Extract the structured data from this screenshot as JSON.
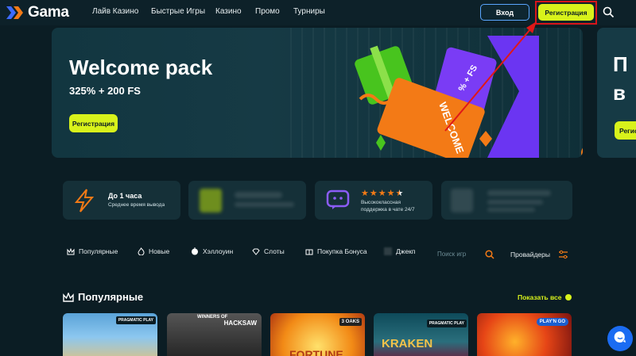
{
  "header": {
    "logo_text": "Gama",
    "nav": [
      "Лайв Казино",
      "Быстрые Игры",
      "Казино",
      "Промо",
      "Турниры"
    ],
    "login_label": "Вход",
    "register_label": "Регистрация"
  },
  "hero": {
    "title": "Welcome pack",
    "subtitle": "325% + 200 FS",
    "button_label": "Регистрация",
    "art_text": "WELCOME",
    "art_text2": "% + FS",
    "next_title": "П\nв",
    "next_button": "Регис"
  },
  "features": [
    {
      "title": "До 1 часа",
      "subtitle": "Среднее время вывода"
    },
    {
      "title": "",
      "subtitle": ""
    },
    {
      "title": "",
      "subtitle": "Высококлассная поддержка в чате 24/7",
      "rating": 4.5
    },
    {
      "title": "",
      "subtitle": ""
    }
  ],
  "categories": [
    "Популярные",
    "Новые",
    "Хэллоуин",
    "Слоты",
    "Покупка Бонуса",
    "Джекп"
  ],
  "search_placeholder": "Поиск игр",
  "providers_label": "Провайдеры",
  "popular": {
    "title": "Популярные",
    "show_all": "Показать все"
  },
  "tiles": [
    {
      "provider": "PRAGMATIC PLAY"
    },
    {
      "provider": "HACKSAW",
      "title": "WINNERS OF"
    },
    {
      "provider": "3 OAKS",
      "title": "FORTUNE"
    },
    {
      "provider": "PRAGMATIC PLAY",
      "title": "KRAKEN"
    },
    {
      "provider": "PLAY'N GO"
    }
  ],
  "colors": {
    "accent": "#d8f21b",
    "orange": "#f37a16",
    "bg": "#0b1d24",
    "highlight": "#d8151a"
  }
}
